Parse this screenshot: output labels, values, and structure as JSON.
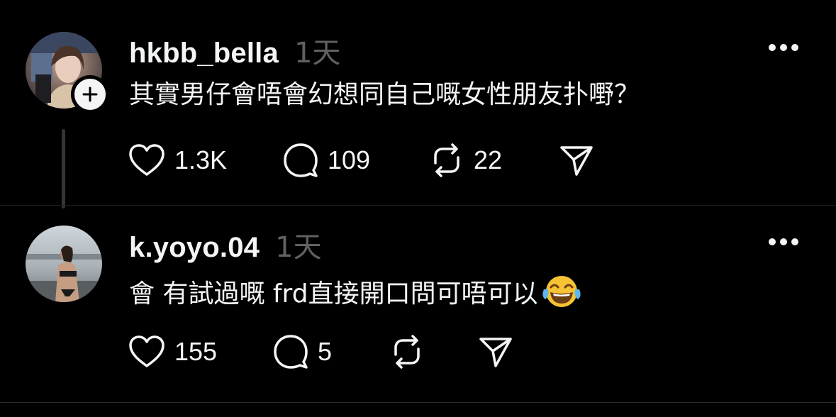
{
  "colors": {
    "background": "#000000",
    "primary_text": "#f3f5f7",
    "secondary_text": "#616161",
    "thread_line": "#333638"
  },
  "posts": [
    {
      "username": "hkbb_bella",
      "time": "1天",
      "content": "其實男仔會唔會幻想同自己嘅女性朋友扑嘢？",
      "has_follow_badge": true,
      "avatar_icon": "user-avatar-photo",
      "stats": {
        "likes": "1.3K",
        "replies": "109",
        "reposts": "22"
      }
    },
    {
      "username": "k.yoyo.04",
      "time": "1天",
      "content": "會 有試過嘅 frd直接開口問可唔可以",
      "emoji": "face-with-tears-of-joy",
      "avatar_icon": "user-avatar-photo",
      "stats": {
        "likes": "155",
        "replies": "5",
        "reposts": ""
      }
    }
  ],
  "icons": {
    "like": "heart-icon",
    "reply": "comment-bubble-icon",
    "repost": "repost-icon",
    "share": "send-icon",
    "more": "more-dots-icon",
    "follow": "plus-icon"
  }
}
